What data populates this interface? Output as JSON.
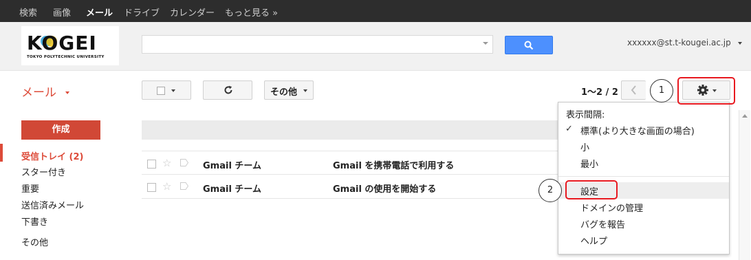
{
  "topnav": {
    "items": [
      "検索",
      "画像",
      "メール",
      "ドライブ",
      "カレンダー",
      "もっと見る »"
    ]
  },
  "logo": {
    "text": "KOGEI",
    "subtext": "TOKYO POLYTECHNIC UNIVERSITY"
  },
  "search": {
    "value": "",
    "placeholder": ""
  },
  "account": {
    "email": "xxxxxx@st.t-kougei.ac.jp"
  },
  "toolbar": {
    "mail_label": "メール",
    "more_label": "その他",
    "pager": "1～2 / 2"
  },
  "sidebar": {
    "compose": "作成",
    "items": [
      "受信トレイ (2)",
      "スター付き",
      "重要",
      "送信済みメール",
      "下書き",
      "その他"
    ]
  },
  "messages": [
    {
      "sender": "Gmail チーム",
      "subject": "Gmail を携帯電話で利用する"
    },
    {
      "sender": "Gmail チーム",
      "subject": "Gmail の使用を開始する"
    }
  ],
  "settings_menu": {
    "density_header": "表示間隔:",
    "density_options": [
      "標準(より大きな画面の場合)",
      "小",
      "最小"
    ],
    "selected_density": "標準(より大きな画面の場合)",
    "items": [
      "設定",
      "ドメインの管理",
      "バグを報告",
      "ヘルプ"
    ]
  },
  "annotations": {
    "step1": "1",
    "step2": "2",
    "highlight_color": "#e8181f"
  },
  "colors": {
    "accent": "#dd4b39",
    "compose": "#d14836",
    "search_button": "#4d90fe"
  }
}
